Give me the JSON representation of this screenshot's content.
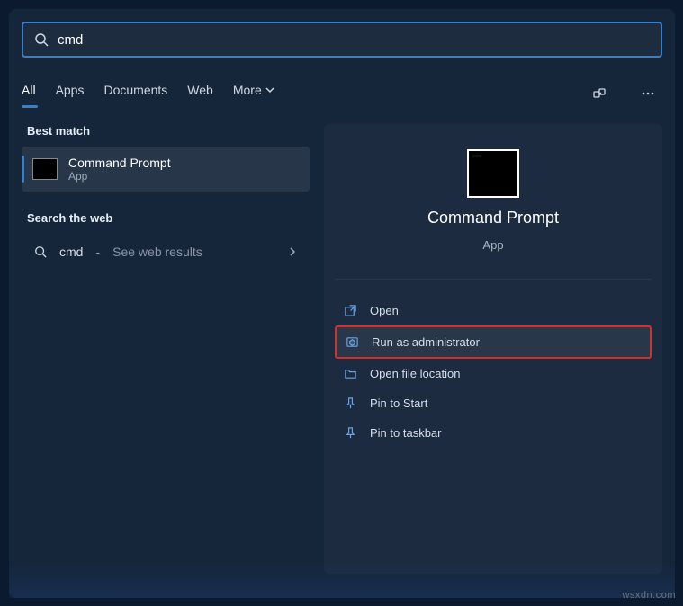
{
  "search": {
    "value": "cmd"
  },
  "tabs": {
    "all": "All",
    "apps": "Apps",
    "documents": "Documents",
    "web": "Web",
    "more": "More"
  },
  "sections": {
    "best_match": "Best match",
    "search_web": "Search the web"
  },
  "result": {
    "title": "Command Prompt",
    "subtitle": "App"
  },
  "web_result": {
    "term": "cmd",
    "hint": "See web results"
  },
  "preview": {
    "title": "Command Prompt",
    "subtitle": "App"
  },
  "actions": {
    "open": "Open",
    "run_admin": "Run as administrator",
    "open_location": "Open file location",
    "pin_start": "Pin to Start",
    "pin_taskbar": "Pin to taskbar"
  },
  "watermark": "wsxdn.com"
}
